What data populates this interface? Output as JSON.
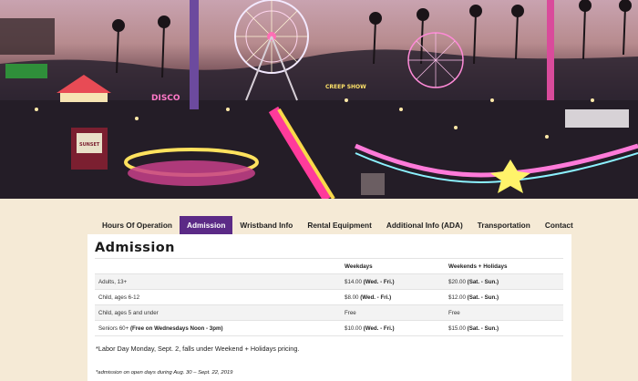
{
  "tabs": [
    {
      "label": "Hours Of Operation"
    },
    {
      "label": "Admission"
    },
    {
      "label": "Wristband Info"
    },
    {
      "label": "Rental Equipment"
    },
    {
      "label": "Additional Info (ADA)"
    },
    {
      "label": "Transportation"
    },
    {
      "label": "Contact"
    }
  ],
  "active_tab": "Admission",
  "hero": {
    "signs": [
      "CREEP SHOW",
      "DISCO",
      "SUNSET"
    ]
  },
  "page_title": "Admission",
  "table": {
    "headers": [
      "",
      "Weekdays",
      "Weekends + Holidays"
    ],
    "rows": [
      {
        "label": "Adults, 13+",
        "label_bold": "",
        "weekday_price": "$14.00",
        "weekday_note": "(Wed. - Fri.)",
        "weekend_price": "$20.00",
        "weekend_note": "(Sat. - Sun.)"
      },
      {
        "label": "Child, ages 6-12",
        "label_bold": "",
        "weekday_price": "$8.00",
        "weekday_note": "(Wed. - Fri.)",
        "weekend_price": "$12.00",
        "weekend_note": "(Sat. - Sun.)"
      },
      {
        "label": "Child, ages 5 and under",
        "label_bold": "",
        "weekday_price": "Free",
        "weekday_note": "",
        "weekend_price": "Free",
        "weekend_note": ""
      },
      {
        "label": "Seniors 60+",
        "label_bold": "(Free on Wednesdays Noon - 3pm)",
        "weekday_price": "$10.00",
        "weekday_note": "(Wed. - Fri.)",
        "weekend_price": "$15.00",
        "weekend_note": "(Sat. - Sun.)"
      }
    ]
  },
  "notes": {
    "labor_day": "*Labor Day Monday, Sept. 2, falls under Weekend + Holidays pricing.",
    "open_days": "*admission on open days during Aug. 30 – Sept. 22, 2019"
  },
  "colors": {
    "active_tab": "#5b2a86",
    "background": "#f5ead6"
  }
}
